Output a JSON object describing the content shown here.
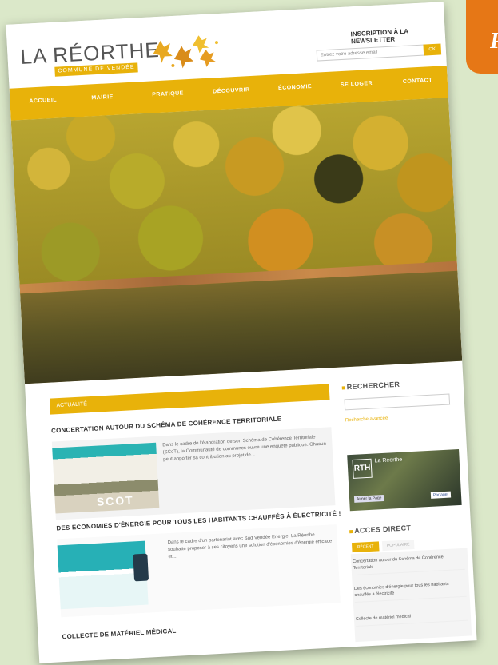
{
  "header": {
    "logo_title": "LA RÉORTHE",
    "logo_subtitle": "COMMUNE DE VENDÉE",
    "newsletter_title": "INSCRIPTION À LA NEWSLETTER",
    "newsletter_placeholder": "Entrez votre adresse email",
    "newsletter_button": "OK"
  },
  "nav": {
    "items": [
      "ACCUEIL",
      "MAIRIE",
      "PRATIQUE",
      "DÉCOUVRIR",
      "ÉCONOMIE",
      "SE LOGER",
      "CONTACT"
    ]
  },
  "news": {
    "bar_label": "ACTUALITÉ",
    "articles": [
      {
        "title": "CONCERTATION AUTOUR DU SCHÉMA DE COHÉRENCE TERRITORIALE",
        "text": "Dans le cadre de l'élaboration de son Schéma de Cohérence Territoriale (SCoT), la Communauté de communes ouvre une enquête publique. Chacun peut apporter sa contribution au projet de...",
        "thumb_label": "SCOT"
      },
      {
        "title": "DES ÉCONOMIES D'ÉNERGIE POUR TOUS LES HABITANTS CHAUFFÉS À ÉLECTRICITÉ !",
        "text": "Dans le cadre d'un partenariat avec Sud Vendée Energie, La Réorthe souhaite proposer à ses citoyens une solution d'économies d'énergie efficace et...",
        "thumb_label": ""
      },
      {
        "title": "COLLECTE DE MATÉRIEL MÉDICAL",
        "text": "",
        "thumb_label": ""
      }
    ]
  },
  "sidebar": {
    "search_title": "RECHERCHER",
    "search_link": "Recherche avancée",
    "facebook_name": "La Réorthe",
    "facebook_like": "Aimer la Page",
    "facebook_share": "Partager",
    "facebook_logo": "RTH",
    "direct_title": "ACCES DIRECT",
    "tabs": [
      "RÉCENT",
      "POPULAIRE"
    ],
    "direct_items": [
      "Concertation autour du Schéma de Cohérence Territoriale",
      "Des économies d'énergie pour tous les habitants chauffés à électricité",
      "Collecte de matériel médical"
    ]
  },
  "badge": {
    "letter": "P"
  },
  "colors": {
    "accent": "#e8b20a",
    "orange_tab": "#e67716",
    "background": "#dbe8c9"
  }
}
